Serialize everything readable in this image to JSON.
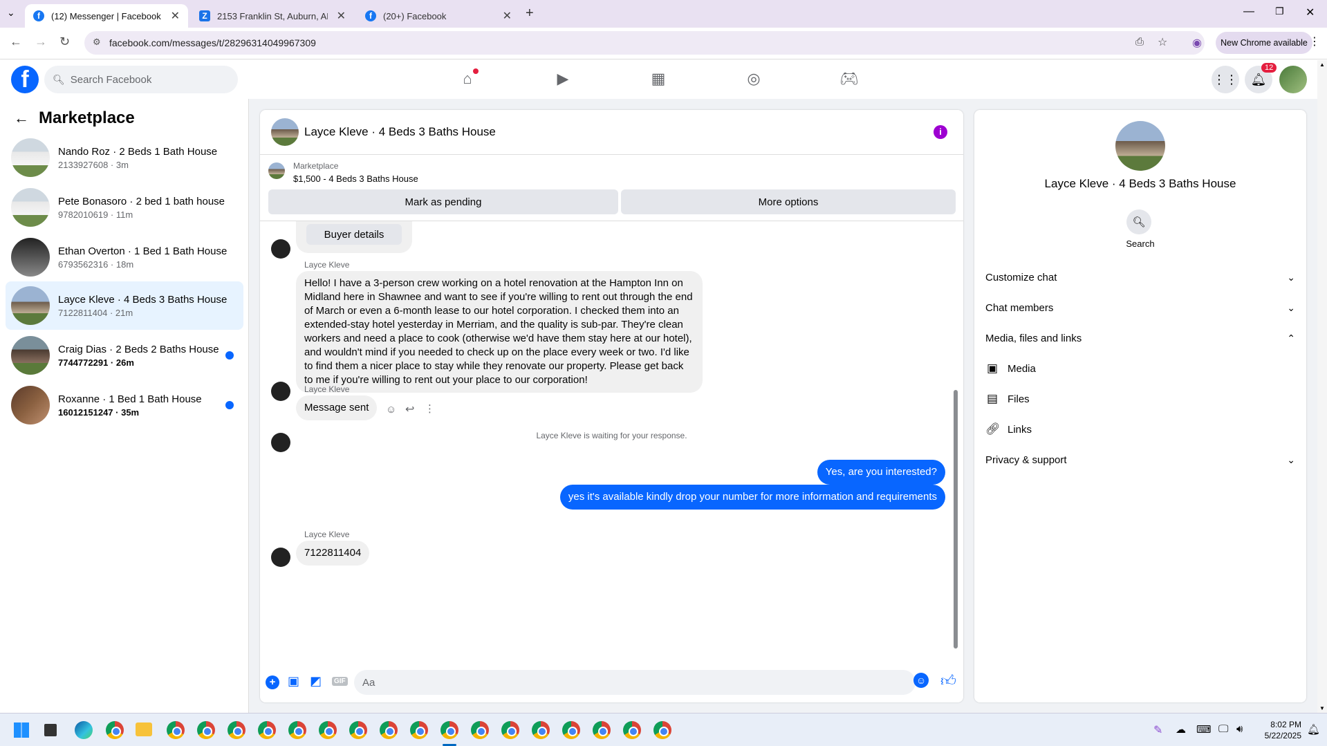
{
  "browser": {
    "tabs": [
      {
        "title": "(12) Messenger | Facebook"
      },
      {
        "title": "2153 Franklin St, Auburn, AL 36"
      },
      {
        "title": "(20+) Facebook"
      }
    ],
    "url": "facebook.com/messages/t/28296314049967309",
    "chrome_update": "New Chrome available"
  },
  "header": {
    "search_placeholder": "Search Facebook",
    "notif_count": "12"
  },
  "sidebar": {
    "title": "Marketplace",
    "conversations": [
      {
        "name": "Nando Roz · 2 Beds 1 Bath House",
        "sub": "2133927608 · 3m"
      },
      {
        "name": "Pete Bonasoro · 2 bed 1 bath house",
        "sub": "9782010619 · 11m"
      },
      {
        "name": "Ethan Overton · 1 Bed 1 Bath House",
        "sub": "6793562316 · 18m"
      },
      {
        "name": "Layce Kleve · 4 Beds 3 Baths House",
        "sub": "7122811404 · 21m"
      },
      {
        "name": "Craig Dias · 2 Beds 2 Baths House",
        "sub": "7744772291 · 26m"
      },
      {
        "name": "Roxanne · 1 Bed 1 Bath House",
        "sub": "16012151247 · 35m"
      }
    ]
  },
  "chat": {
    "title": "Layce Kleve · 4 Beds 3 Baths House",
    "listing_label": "Marketplace",
    "listing_price": "$1,500 - 4 Beds 3 Baths House",
    "mark_pending": "Mark as pending",
    "more_options": "More options",
    "buyer_details": "Buyer details",
    "sender": "Layce Kleve",
    "msg1": "Hello! I have a 3-person crew working on a hotel renovation at the Hampton Inn on Midland here in Shawnee and want to see if you're willing to rent out through the end of March or even a 6-month lease to our hotel corporation. I checked them into an extended-stay hotel yesterday in Merriam, and the quality is sub-par. They're clean workers and need a place to cook (otherwise we'd have them stay here at our hotel), and wouldn't mind if you needed to check up on the place every week or two. I'd like to find them a nicer place to stay while they renovate our property. Please get back to me if you're willing to rent out your place to our corporation!",
    "msg2": "Message sent",
    "waiting": "Layce Kleve is waiting for your response.",
    "out1": "Yes, are you interested?",
    "out2": "yes it's available kindly drop your number for more information and requirements",
    "msg3": "7122811404",
    "composer_placeholder": "Aa"
  },
  "details": {
    "name": "Layce Kleve · 4 Beds 3 Baths House",
    "search": "Search",
    "customize": "Customize chat",
    "members": "Chat members",
    "media_files": "Media, files and links",
    "media": "Media",
    "files": "Files",
    "links": "Links",
    "privacy": "Privacy & support"
  },
  "taskbar": {
    "time": "8:02 PM",
    "date": "5/22/2025"
  },
  "colors": {
    "brand": "#1877f2",
    "accent": "#0866ff"
  }
}
